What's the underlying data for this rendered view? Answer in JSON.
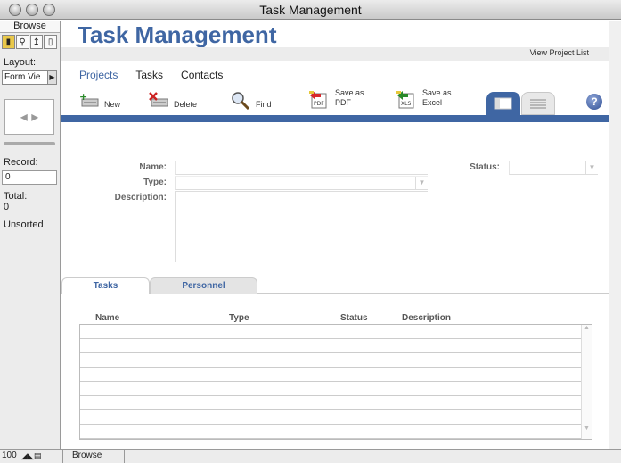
{
  "window": {
    "title": "Task Management"
  },
  "leftpane": {
    "mode_header": "Browse",
    "layout_label": "Layout:",
    "layout_value": "Form Vie",
    "record_label": "Record:",
    "record_value": "0",
    "total_label": "Total:",
    "total_value": "0",
    "sort_status": "Unsorted"
  },
  "header": {
    "app_title": "Task Management",
    "view_project_list": "View Project List"
  },
  "nav": {
    "items": [
      "Projects",
      "Tasks",
      "Contacts"
    ],
    "active": "Projects"
  },
  "toolbar": {
    "new": "New",
    "delete": "Delete",
    "find": "Find",
    "save_pdf_line1": "Save as",
    "save_pdf_line2": "PDF",
    "save_excel_line1": "Save as",
    "save_excel_line2": "Excel",
    "help": "?"
  },
  "form": {
    "name_label": "Name:",
    "type_label": "Type:",
    "description_label": "Description:",
    "status_label": "Status:"
  },
  "tabs": [
    "Tasks",
    "Personnel"
  ],
  "portal": {
    "columns": [
      "Name",
      "Type",
      "Status",
      "Description"
    ],
    "rows": 8
  },
  "statusbar": {
    "zoom": "100",
    "mode": "Browse"
  },
  "colors": {
    "accent": "#3f66a3"
  }
}
